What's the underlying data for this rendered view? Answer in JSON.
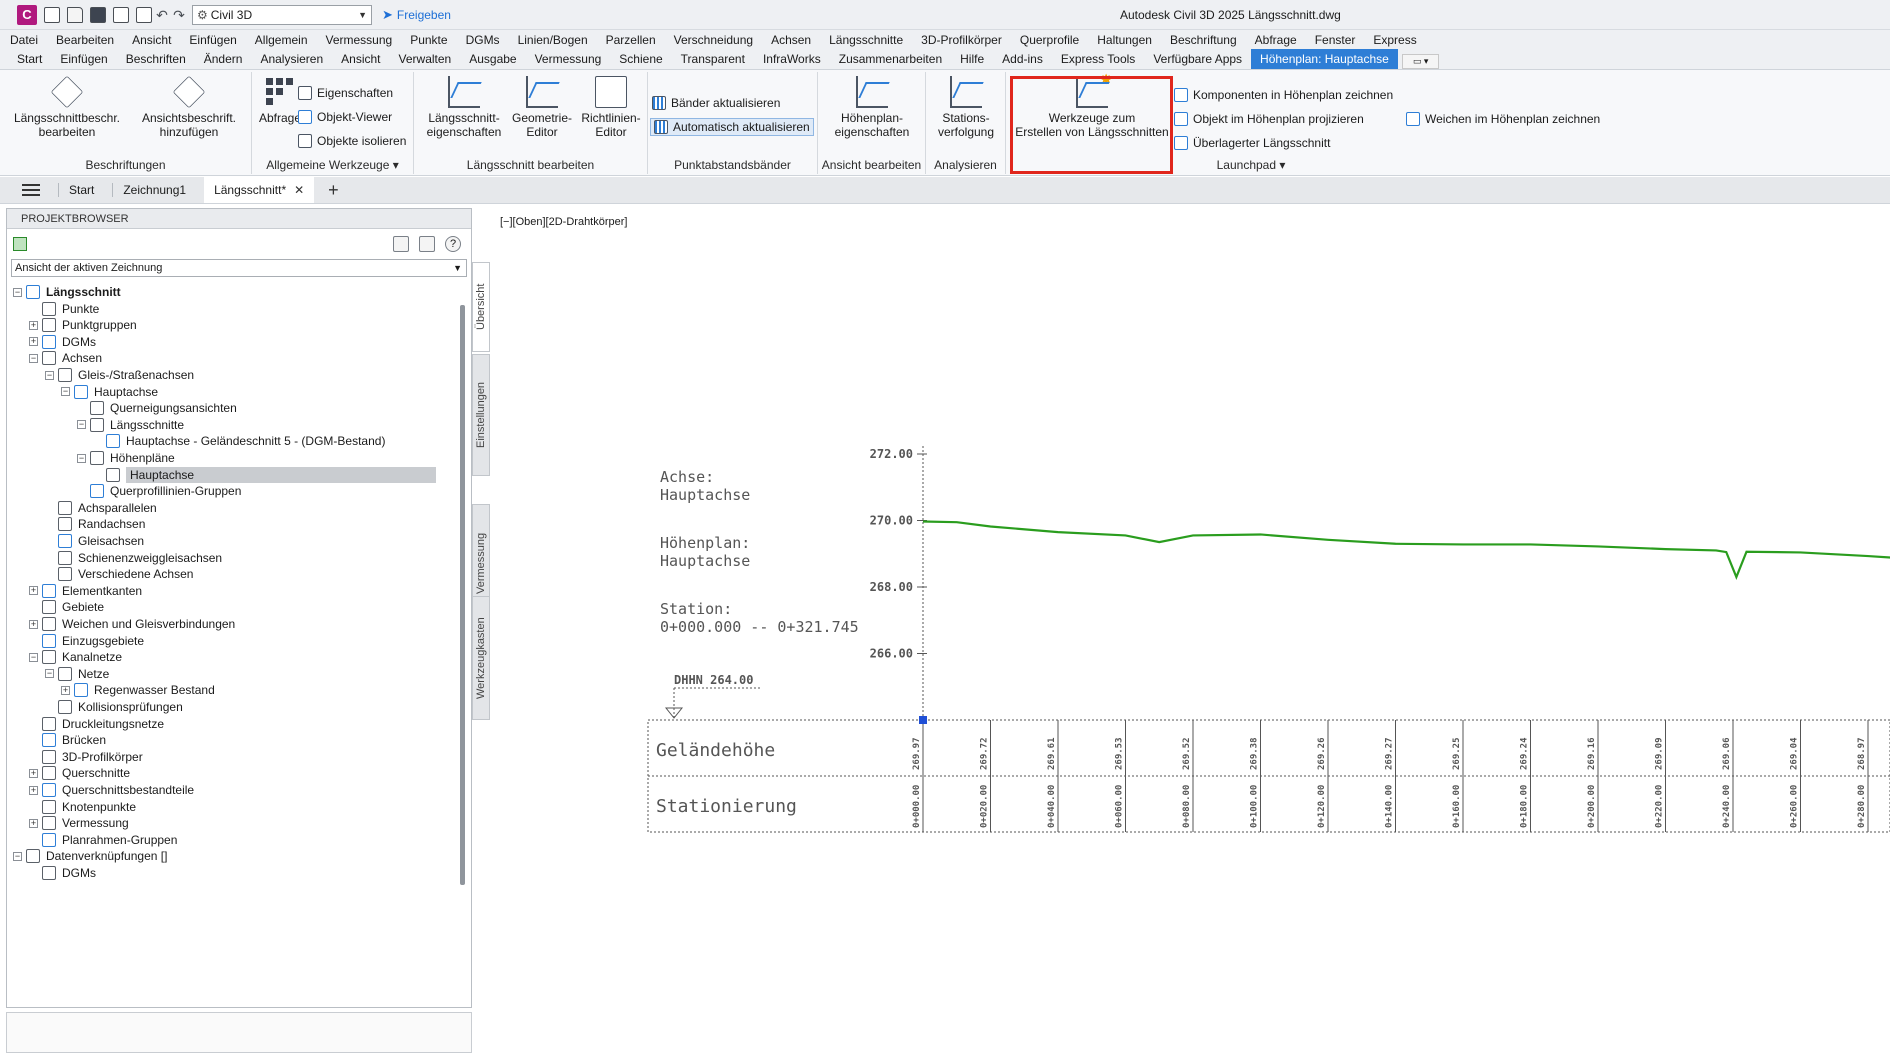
{
  "app": {
    "logo_letter": "C",
    "workspace": "Civil 3D",
    "share_label": "Freigeben",
    "window_title": "Autodesk Civil 3D 2025    Längsschnitt.dwg"
  },
  "menu": [
    "Datei",
    "Bearbeiten",
    "Ansicht",
    "Einfügen",
    "Allgemein",
    "Vermessung",
    "Punkte",
    "DGMs",
    "Linien/Bogen",
    "Parzellen",
    "Verschneidung",
    "Achsen",
    "Längsschnitte",
    "3D-Profilkörper",
    "Querprofile",
    "Haltungen",
    "Beschriftung",
    "Abfrage",
    "Fenster",
    "Express"
  ],
  "ribbon_tabs": [
    "Start",
    "Einfügen",
    "Beschriften",
    "Ändern",
    "Analysieren",
    "Ansicht",
    "Verwalten",
    "Ausgabe",
    "Vermessung",
    "Schiene",
    "Transparent",
    "InfraWorks",
    "Zusammenarbeiten",
    "Hilfe",
    "Add-ins",
    "Express Tools",
    "Verfügbare Apps",
    "Höhenplan: Hauptachse"
  ],
  "ribbon": {
    "panels": {
      "beschriftungen": "Beschriftungen",
      "allgemeine": "Allgemeine Werkzeuge",
      "laengsschnitt": "Längsschnitt bearbeiten",
      "punktabstand": "Punktabstandsbänder",
      "ansicht": "Ansicht bearbeiten",
      "analysieren": "Analysieren",
      "launchpad": "Launchpad"
    },
    "buttons": {
      "lsb_line1": "Längsschnittbeschr.",
      "lsb_line2": "bearbeiten",
      "ab_line1": "Ansichtsbeschrift.",
      "ab_line2": "hinzufügen",
      "abfrage": "Abfrage",
      "eigenschaften": "Eigenschaften",
      "objekt_viewer": "Objekt-Viewer",
      "objekte_isolieren": "Objekte isolieren",
      "ls_eig_line1": "Längsschnitt-",
      "ls_eig_line2": "eigenschaften",
      "geo_line1": "Geometrie-",
      "geo_line2": "Editor",
      "rl_line1": "Richtlinien-",
      "rl_line2": "Editor",
      "baender": "Bänder aktualisieren",
      "auto": "Automatisch aktualisieren",
      "hp_line1": "Höhenplan-",
      "hp_line2": "eigenschaften",
      "sv_line1": "Stations-",
      "sv_line2": "verfolgung",
      "wz_line1": "Werkzeuge zum",
      "wz_line2": "Erstellen von Längsschnitten",
      "komponenten": "Komponenten in Höhenplan zeichnen",
      "projizieren": "Objekt im Höhenplan projizieren",
      "ueberlagert": "Überlagerter Längsschnitt",
      "weichen": "Weichen im Höhenplan zeichnen"
    }
  },
  "doc_tabs": {
    "start": "Start",
    "tab1": "Zeichnung1",
    "tab2": "Längsschnitt*"
  },
  "browser": {
    "title": "PROJEKTBROWSER",
    "view": "Ansicht der aktiven Zeichnung",
    "tree": [
      {
        "label": "Längsschnitt",
        "level": 0,
        "exp": "−",
        "bold": true
      },
      {
        "label": "Punkte",
        "level": 1,
        "exp": ""
      },
      {
        "label": "Punktgruppen",
        "level": 1,
        "exp": "+"
      },
      {
        "label": "DGMs",
        "level": 1,
        "exp": "+"
      },
      {
        "label": "Achsen",
        "level": 1,
        "exp": "−"
      },
      {
        "label": "Gleis-/Straßenachsen",
        "level": 2,
        "exp": "−"
      },
      {
        "label": "Hauptachse",
        "level": 3,
        "exp": "−"
      },
      {
        "label": "Querneigungsansichten",
        "level": 4,
        "exp": ""
      },
      {
        "label": "Längsschnitte",
        "level": 4,
        "exp": "−"
      },
      {
        "label": "Hauptachse - Geländeschnitt 5 - (DGM-Bestand)",
        "level": 5,
        "exp": ""
      },
      {
        "label": "Höhenpläne",
        "level": 4,
        "exp": "−"
      },
      {
        "label": "Hauptachse",
        "level": 5,
        "exp": "",
        "selected": true
      },
      {
        "label": "Querprofillinien-Gruppen",
        "level": 4,
        "exp": ""
      },
      {
        "label": "Achsparallelen",
        "level": 2,
        "exp": ""
      },
      {
        "label": "Randachsen",
        "level": 2,
        "exp": ""
      },
      {
        "label": "Gleisachsen",
        "level": 2,
        "exp": ""
      },
      {
        "label": "Schienenzweiggleisachsen",
        "level": 2,
        "exp": ""
      },
      {
        "label": "Verschiedene Achsen",
        "level": 2,
        "exp": ""
      },
      {
        "label": "Elementkanten",
        "level": 1,
        "exp": "+"
      },
      {
        "label": "Gebiete",
        "level": 1,
        "exp": ""
      },
      {
        "label": "Weichen und Gleisverbindungen",
        "level": 1,
        "exp": "+"
      },
      {
        "label": "Einzugsgebiete",
        "level": 1,
        "exp": ""
      },
      {
        "label": "Kanalnetze",
        "level": 1,
        "exp": "−"
      },
      {
        "label": "Netze",
        "level": 2,
        "exp": "−"
      },
      {
        "label": "Regenwasser Bestand",
        "level": 3,
        "exp": "+"
      },
      {
        "label": "Kollisionsprüfungen",
        "level": 2,
        "exp": ""
      },
      {
        "label": "Druckleitungsnetze",
        "level": 1,
        "exp": ""
      },
      {
        "label": "Brücken",
        "level": 1,
        "exp": ""
      },
      {
        "label": "3D-Profilkörper",
        "level": 1,
        "exp": ""
      },
      {
        "label": "Querschnitte",
        "level": 1,
        "exp": "+"
      },
      {
        "label": "Querschnittsbestandteile",
        "level": 1,
        "exp": "+"
      },
      {
        "label": "Knotenpunkte",
        "level": 1,
        "exp": ""
      },
      {
        "label": "Vermessung",
        "level": 1,
        "exp": "+"
      },
      {
        "label": "Planrahmen-Gruppen",
        "level": 1,
        "exp": ""
      },
      {
        "label": "Datenverknüpfungen []",
        "level": 0,
        "exp": "−"
      },
      {
        "label": "DGMs",
        "level": 1,
        "exp": ""
      }
    ],
    "side_tabs": [
      "Übersicht",
      "Einstellungen",
      "Vermessung",
      "Werkzeugkasten"
    ]
  },
  "viewport_label": "[−][Oben][2D-Drahtkörper]",
  "drawing": {
    "info_lines": [
      "Achse:",
      "Hauptachse",
      "Höhenplan:",
      "Hauptachse",
      "Station:",
      "0+000.000  --  0+321.745"
    ],
    "datum_label": "DHHN 264.00",
    "band1_title": "Geländehöhe",
    "band2_title": "Stationierung",
    "y_ticks": [
      "272.00",
      "270.00",
      "268.00",
      "266.00"
    ]
  },
  "chart_data": {
    "type": "line",
    "title": "",
    "xlabel": "",
    "ylabel": "",
    "ylim": [
      264,
      272
    ],
    "series": [
      {
        "x": [
          0,
          10,
          20,
          40,
          60,
          70,
          80,
          100,
          120,
          140,
          160,
          180,
          200,
          220,
          235,
          238,
          241,
          244,
          260,
          280,
          300
        ],
        "values": [
          269.97,
          269.95,
          269.82,
          269.65,
          269.55,
          269.35,
          269.55,
          269.58,
          269.42,
          269.3,
          269.28,
          269.28,
          269.22,
          269.14,
          269.1,
          269.05,
          268.3,
          269.06,
          269.04,
          268.93,
          268.8
        ]
      }
    ],
    "band_elevations": [
      "269.97",
      "269.72",
      "269.61",
      "269.53",
      "269.52",
      "269.38",
      "269.26",
      "269.27",
      "269.25",
      "269.24",
      "269.16",
      "269.09",
      "269.06",
      "269.04",
      "268.97"
    ],
    "band_stations": [
      "0+000.00",
      "0+020.00",
      "0+040.00",
      "0+060.00",
      "0+080.00",
      "0+100.00",
      "0+120.00",
      "0+140.00",
      "0+160.00",
      "0+180.00",
      "0+200.00",
      "0+220.00",
      "0+240.00",
      "0+260.00",
      "0+280.00"
    ]
  }
}
